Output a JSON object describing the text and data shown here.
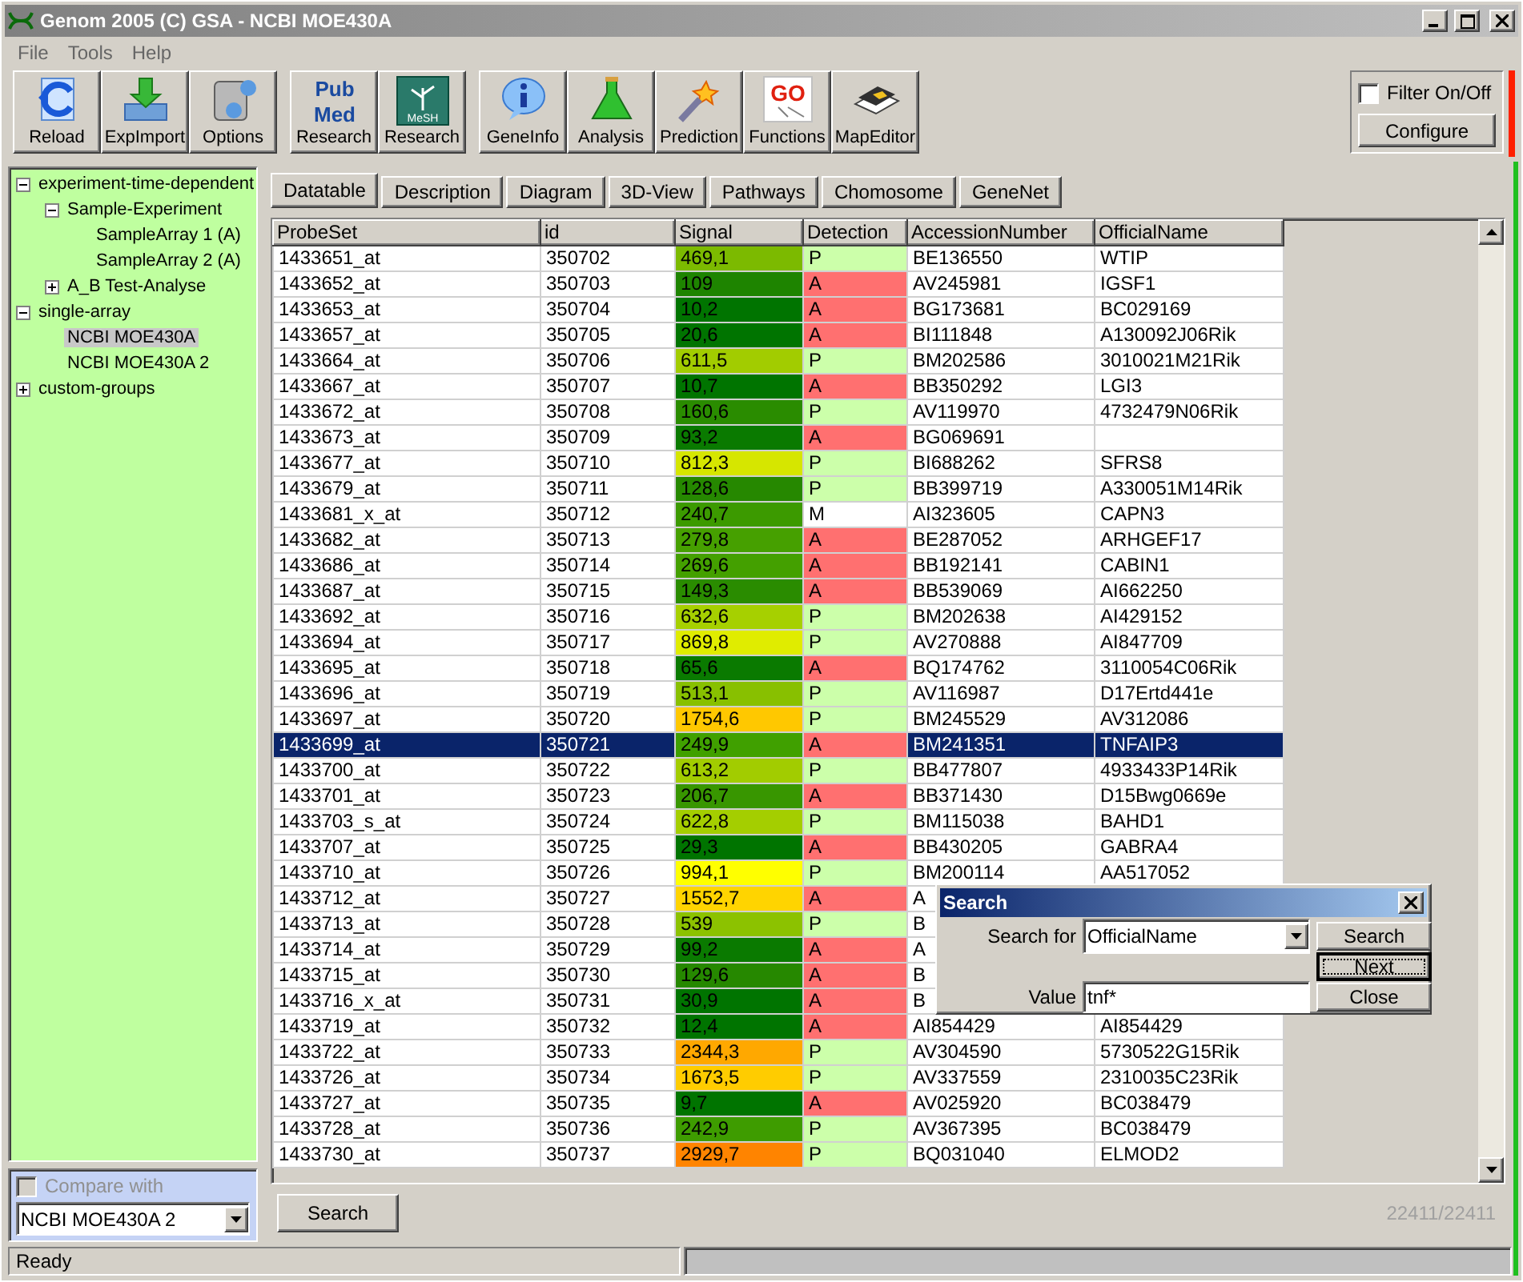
{
  "window": {
    "title": "Genom 2005 (C) GSA - NCBI MOE430A"
  },
  "menu": [
    "File",
    "Tools",
    "Help"
  ],
  "toolbar": [
    {
      "kind": "reload",
      "label": "Reload"
    },
    {
      "kind": "import",
      "label": "ExpImport"
    },
    {
      "kind": "options",
      "label": "Options"
    },
    {
      "kind": "pubmed",
      "label": "Research",
      "logo": [
        "Pub",
        "Med"
      ],
      "group_start": true
    },
    {
      "kind": "mesh",
      "label": "Research",
      "logo": [
        "MeSH"
      ]
    },
    {
      "kind": "info",
      "label": "GeneInfo",
      "group_start": true
    },
    {
      "kind": "flask",
      "label": "Analysis"
    },
    {
      "kind": "wand",
      "label": "Prediction"
    },
    {
      "kind": "go",
      "label": "Functions",
      "logo": [
        "GO"
      ]
    },
    {
      "kind": "map",
      "label": "MapEditor"
    }
  ],
  "filter": {
    "label": "Filter On/Off",
    "checked": false,
    "button": "Configure"
  },
  "tree": [
    {
      "label": "experiment-time-dependent",
      "expanded": true,
      "selected": false,
      "children": [
        {
          "label": "Sample-Experiment",
          "expanded": true,
          "selected": false,
          "children": [
            {
              "label": "SampleArray 1 (A)",
              "selected": false
            },
            {
              "label": "SampleArray 2 (A)",
              "selected": false
            }
          ]
        },
        {
          "label": "A_B Test-Analyse",
          "expanded": false,
          "selected": false
        }
      ]
    },
    {
      "label": "single-array",
      "expanded": true,
      "selected": false,
      "children": [
        {
          "label": "NCBI MOE430A",
          "selected": true
        },
        {
          "label": "NCBI MOE430A 2",
          "selected": false
        }
      ]
    },
    {
      "label": "custom-groups",
      "expanded": false,
      "selected": false
    }
  ],
  "compare": {
    "label": "Compare with",
    "checked": false,
    "disabled": true,
    "value": "NCBI MOE430A 2"
  },
  "tabs": [
    {
      "label": "Datatable",
      "selected": true
    },
    {
      "label": "Description",
      "selected": false
    },
    {
      "label": "Diagram",
      "selected": false
    },
    {
      "label": "3D-View",
      "selected": false
    },
    {
      "label": "Pathways",
      "selected": false
    },
    {
      "label": "Chomosome",
      "selected": false
    },
    {
      "label": "GeneNet",
      "selected": false
    }
  ],
  "table": {
    "columns": [
      "ProbeSet",
      "id",
      "Signal",
      "Detection",
      "AccessionNumber",
      "OfficialName"
    ],
    "rows": [
      {
        "probe": "1433651_at",
        "id": "350702",
        "signal": {
          "value": "469,1",
          "color": "#7cba00"
        },
        "detection": {
          "value": "P",
          "color": "#ccffaa"
        },
        "accession": "BE136550",
        "official": "WTIP",
        "selected": false
      },
      {
        "probe": "1433652_at",
        "id": "350703",
        "signal": {
          "value": "109",
          "color": "#1e8400"
        },
        "detection": {
          "value": "A",
          "color": "#ff7070"
        },
        "accession": "AV245981",
        "official": "IGSF1",
        "selected": false
      },
      {
        "probe": "1433653_at",
        "id": "350704",
        "signal": {
          "value": "10,2",
          "color": "#007400"
        },
        "detection": {
          "value": "A",
          "color": "#ff7070"
        },
        "accession": "BG173681",
        "official": "BC029169",
        "selected": false
      },
      {
        "probe": "1433657_at",
        "id": "350705",
        "signal": {
          "value": "20,6",
          "color": "#007400"
        },
        "detection": {
          "value": "A",
          "color": "#ff7070"
        },
        "accession": "BI111848",
        "official": "A130092J06Rik",
        "selected": false
      },
      {
        "probe": "1433664_at",
        "id": "350706",
        "signal": {
          "value": "611,5",
          "color": "#a2cc00"
        },
        "detection": {
          "value": "P",
          "color": "#ccffaa"
        },
        "accession": "BM202586",
        "official": "3010021M21Rik",
        "selected": false
      },
      {
        "probe": "1433667_at",
        "id": "350707",
        "signal": {
          "value": "10,7",
          "color": "#007400"
        },
        "detection": {
          "value": "A",
          "color": "#ff7070"
        },
        "accession": "BB350292",
        "official": "LGI3",
        "selected": false
      },
      {
        "probe": "1433672_at",
        "id": "350708",
        "signal": {
          "value": "160,6",
          "color": "#2a8c00"
        },
        "detection": {
          "value": "P",
          "color": "#ccffaa"
        },
        "accession": "AV119970",
        "official": "4732479N06Rik",
        "selected": false
      },
      {
        "probe": "1433673_at",
        "id": "350709",
        "signal": {
          "value": "93,2",
          "color": "#0a7a00"
        },
        "detection": {
          "value": "A",
          "color": "#ff7070"
        },
        "accession": "BG069691",
        "selected": false
      },
      {
        "probe": "1433677_at",
        "id": "350710",
        "signal": {
          "value": "812,3",
          "color": "#d6e600"
        },
        "detection": {
          "value": "P",
          "color": "#ccffaa"
        },
        "accession": "BI688262",
        "official": "SFRS8",
        "selected": false
      },
      {
        "probe": "1433679_at",
        "id": "350711",
        "signal": {
          "value": "128,6",
          "color": "#268800"
        },
        "detection": {
          "value": "P",
          "color": "#ccffaa"
        },
        "accession": "BB399719",
        "official": "A330051M14Rik",
        "selected": false
      },
      {
        "probe": "1433681_x_at",
        "id": "350712",
        "signal": {
          "value": "240,7",
          "color": "#3c9a00"
        },
        "detection": {
          "value": "M",
          "color": "#ffffff"
        },
        "accession": "AI323605",
        "official": "CAPN3",
        "selected": false
      },
      {
        "probe": "1433682_at",
        "id": "350713",
        "signal": {
          "value": "279,8",
          "color": "#46a000"
        },
        "detection": {
          "value": "A",
          "color": "#ff7070"
        },
        "accession": "BE287052",
        "official": "ARHGEF17",
        "selected": false
      },
      {
        "probe": "1433686_at",
        "id": "350714",
        "signal": {
          "value": "269,6",
          "color": "#44a000"
        },
        "detection": {
          "value": "A",
          "color": "#ff7070"
        },
        "accession": "BB192141",
        "official": "CABIN1",
        "selected": false
      },
      {
        "probe": "1433687_at",
        "id": "350715",
        "signal": {
          "value": "149,3",
          "color": "#2a8c00"
        },
        "detection": {
          "value": "A",
          "color": "#ff7070"
        },
        "accession": "BB539069",
        "official": "AI662250",
        "selected": false
      },
      {
        "probe": "1433692_at",
        "id": "350716",
        "signal": {
          "value": "632,6",
          "color": "#a6d000"
        },
        "detection": {
          "value": "P",
          "color": "#ccffaa"
        },
        "accession": "BM202638",
        "official": "AI429152",
        "selected": false
      },
      {
        "probe": "1433694_at",
        "id": "350717",
        "signal": {
          "value": "869,8",
          "color": "#e0ec00"
        },
        "detection": {
          "value": "P",
          "color": "#ccffaa"
        },
        "accession": "AV270888",
        "official": "AI847709",
        "selected": false
      },
      {
        "probe": "1433695_at",
        "id": "350718",
        "signal": {
          "value": "65,6",
          "color": "#0a7a00"
        },
        "detection": {
          "value": "A",
          "color": "#ff7070"
        },
        "accession": "BQ174762",
        "official": "3110054C06Rik",
        "selected": false
      },
      {
        "probe": "1433696_at",
        "id": "350719",
        "signal": {
          "value": "513,1",
          "color": "#88c000"
        },
        "detection": {
          "value": "P",
          "color": "#ccffaa"
        },
        "accession": "AV116987",
        "official": "D17Ertd441e",
        "selected": false
      },
      {
        "probe": "1433697_at",
        "id": "350720",
        "signal": {
          "value": "1754,6",
          "color": "#ffc800"
        },
        "detection": {
          "value": "P",
          "color": "#ccffaa"
        },
        "accession": "BM245529",
        "official": "AV312086",
        "selected": false
      },
      {
        "probe": "1433699_at",
        "id": "350721",
        "signal": {
          "value": "249,9",
          "color": "#40a000"
        },
        "detection": {
          "value": "A",
          "color": "#ff7070"
        },
        "accession": "BM241351",
        "official": "TNFAIP3",
        "selected": true
      },
      {
        "probe": "1433700_at",
        "id": "350722",
        "signal": {
          "value": "613,2",
          "color": "#a2cc00"
        },
        "detection": {
          "value": "P",
          "color": "#ccffaa"
        },
        "accession": "BB477807",
        "official": "4933433P14Rik",
        "selected": false
      },
      {
        "probe": "1433701_at",
        "id": "350723",
        "signal": {
          "value": "206,7",
          "color": "#389600"
        },
        "detection": {
          "value": "A",
          "color": "#ff7070"
        },
        "accession": "BB371430",
        "official": "D15Bwg0669e",
        "selected": false
      },
      {
        "probe": "1433703_s_at",
        "id": "350724",
        "signal": {
          "value": "622,8",
          "color": "#a4ce00"
        },
        "detection": {
          "value": "P",
          "color": "#ccffaa"
        },
        "accession": "BM115038",
        "official": "BAHD1",
        "selected": false
      },
      {
        "probe": "1433707_at",
        "id": "350725",
        "signal": {
          "value": "29,3",
          "color": "#007400"
        },
        "detection": {
          "value": "A",
          "color": "#ff7070"
        },
        "accession": "BB430205",
        "official": "GABRA4",
        "selected": false
      },
      {
        "probe": "1433710_at",
        "id": "350726",
        "signal": {
          "value": "994,1",
          "color": "#ffff00"
        },
        "detection": {
          "value": "P",
          "color": "#ccffaa"
        },
        "accession": "BM200114",
        "official": "AA517052",
        "selected": false
      },
      {
        "probe": "1433712_at",
        "id": "350727",
        "signal": {
          "value": "1552,7",
          "color": "#ffd400"
        },
        "detection": {
          "value": "A",
          "color": "#ff7070"
        },
        "accession": "A",
        "selected": false
      },
      {
        "probe": "1433713_at",
        "id": "350728",
        "signal": {
          "value": "539",
          "color": "#8cc200"
        },
        "detection": {
          "value": "P",
          "color": "#ccffaa"
        },
        "accession": "B",
        "selected": false
      },
      {
        "probe": "1433714_at",
        "id": "350729",
        "signal": {
          "value": "99,2",
          "color": "#0a7a00"
        },
        "detection": {
          "value": "A",
          "color": "#ff7070"
        },
        "accession": "A",
        "selected": false
      },
      {
        "probe": "1433715_at",
        "id": "350730",
        "signal": {
          "value": "129,6",
          "color": "#268800"
        },
        "detection": {
          "value": "A",
          "color": "#ff7070"
        },
        "accession": "B",
        "selected": false
      },
      {
        "probe": "1433716_x_at",
        "id": "350731",
        "signal": {
          "value": "30,9",
          "color": "#007400"
        },
        "detection": {
          "value": "A",
          "color": "#ff7070"
        },
        "accession": "B",
        "selected": false
      },
      {
        "probe": "1433719_at",
        "id": "350732",
        "signal": {
          "value": "12,4",
          "color": "#007400"
        },
        "detection": {
          "value": "A",
          "color": "#ff7070"
        },
        "accession": "AI854429",
        "official": "AI854429",
        "selected": false
      },
      {
        "probe": "1433722_at",
        "id": "350733",
        "signal": {
          "value": "2344,3",
          "color": "#ffa800"
        },
        "detection": {
          "value": "P",
          "color": "#ccffaa"
        },
        "accession": "AV304590",
        "official": "5730522G15Rik",
        "selected": false
      },
      {
        "probe": "1433726_at",
        "id": "350734",
        "signal": {
          "value": "1673,5",
          "color": "#ffcc00"
        },
        "detection": {
          "value": "P",
          "color": "#ccffaa"
        },
        "accession": "AV337559",
        "official": "2310035C23Rik",
        "selected": false
      },
      {
        "probe": "1433727_at",
        "id": "350735",
        "signal": {
          "value": "9,7",
          "color": "#007400"
        },
        "detection": {
          "value": "A",
          "color": "#ff7070"
        },
        "accession": "AV025920",
        "official": "BC038479",
        "selected": false
      },
      {
        "probe": "1433728_at",
        "id": "350736",
        "signal": {
          "value": "242,9",
          "color": "#3e9c00"
        },
        "detection": {
          "value": "P",
          "color": "#ccffaa"
        },
        "accession": "AV367395",
        "official": "BC038479",
        "selected": false
      },
      {
        "probe": "1433730_at",
        "id": "350737",
        "signal": {
          "value": "2929,7",
          "color": "#ff8400"
        },
        "detection": {
          "value": "P",
          "color": "#ccffaa"
        },
        "accession": "BQ031040",
        "official": "ELMOD2",
        "selected": false
      }
    ]
  },
  "search_button": "Search",
  "count": "22411/22411",
  "status": "Ready",
  "dialog": {
    "title": "Search",
    "search_for_label": "Search for",
    "search_for": "OfficialName",
    "value_label": "Value",
    "value": "tnf*",
    "buttons": [
      {
        "label": "Search",
        "focused": false
      },
      {
        "label": "Next",
        "focused": true
      },
      {
        "label": "Close",
        "focused": false
      }
    ]
  }
}
